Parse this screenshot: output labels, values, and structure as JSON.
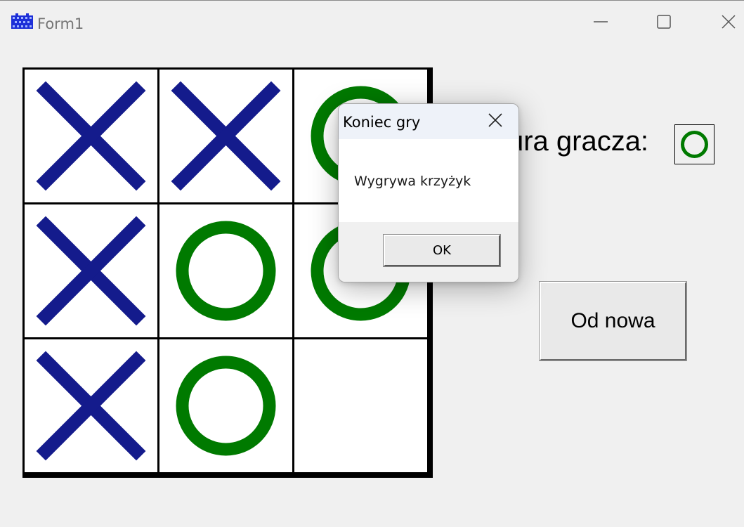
{
  "window": {
    "title": "Form1",
    "icon": "app-grid-icon",
    "controls": [
      "minimize-icon",
      "maximize-icon",
      "close-icon"
    ]
  },
  "board": {
    "cells": [
      [
        "X",
        "X",
        "O"
      ],
      [
        "X",
        "O",
        "O"
      ],
      [
        "X",
        "O",
        ""
      ]
    ],
    "colors": {
      "x": "#141b8c",
      "o": "#007a00"
    }
  },
  "turn": {
    "label": "Tura gracza:",
    "current_symbol": "O"
  },
  "restart_button": {
    "label": "Od nowa"
  },
  "dialog": {
    "title": "Koniec gry",
    "message": "Wygrywa krzyżyk",
    "ok_label": "OK"
  }
}
